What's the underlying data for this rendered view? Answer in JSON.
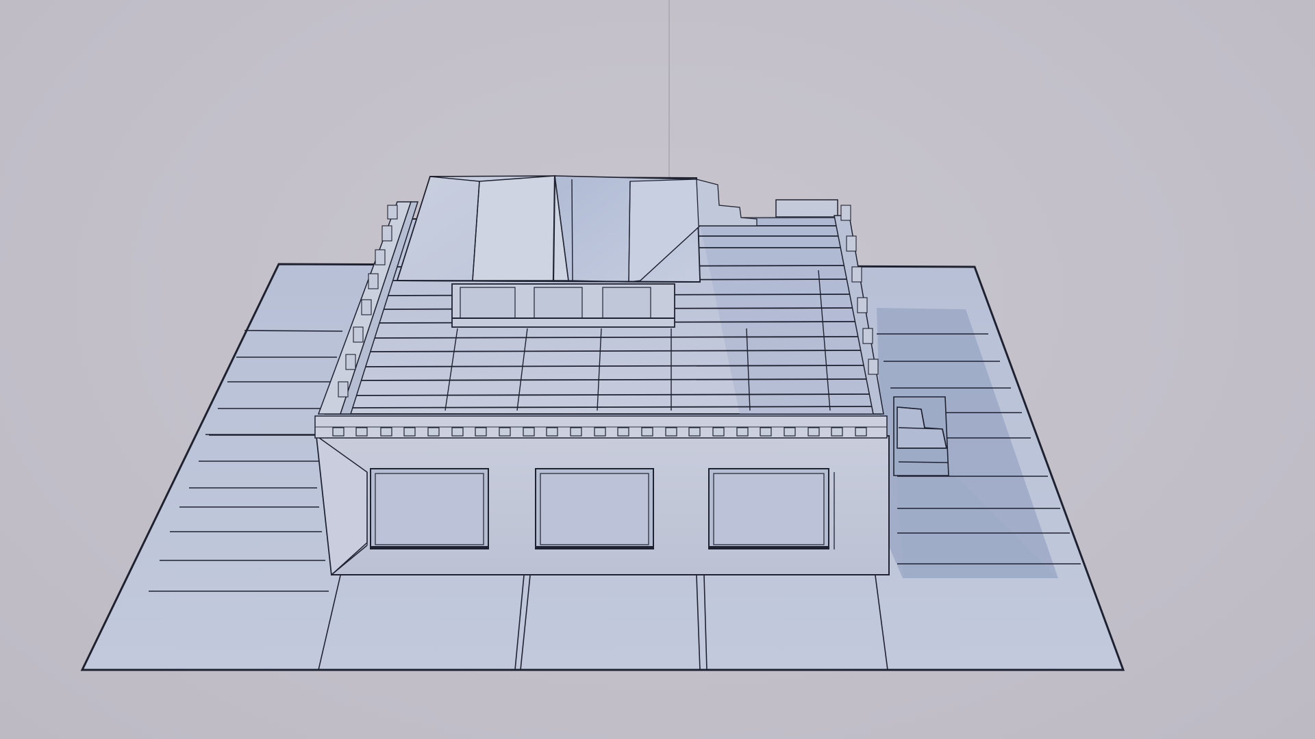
{
  "viewport": {
    "background_color": "#c3c0ca",
    "model_fill_color": "#bcc4d8",
    "model_shadow_color": "#8c9bb9",
    "edge_color": "#1e2230",
    "render_mode": "wireframe-over-solid"
  },
  "scene": {
    "objects": [
      "ground-plane",
      "building-body",
      "flat-roof",
      "roof-skylight",
      "roof-parapet",
      "side-stairs",
      "front-windows",
      "pivot-line"
    ]
  }
}
